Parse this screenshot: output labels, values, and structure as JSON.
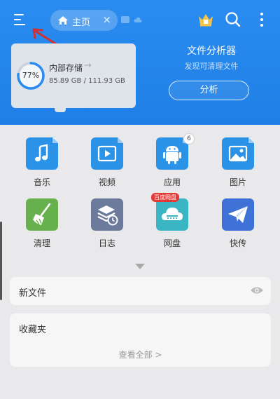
{
  "colors": {
    "accent": "#1f7fe6",
    "background": "#e9e9eb",
    "arrow": "#d32f2f"
  },
  "topbar": {
    "menu_icon": "hamburger-menu-icon",
    "tab": {
      "label": "主页",
      "icon": "home-icon",
      "close": "×"
    },
    "actions": [
      "crown-icon",
      "search-icon",
      "more-vertical-icon"
    ]
  },
  "storage": {
    "percent_label": "77%",
    "used_fraction": 0.77,
    "name": "内部存储",
    "arrow": "→",
    "size": "85.89 GB / 111.93 GB"
  },
  "analyzer": {
    "title": "文件分析器",
    "subtitle": "发现可清理文件",
    "button": "分析"
  },
  "categories": [
    {
      "label": "音乐",
      "icon": "music-icon",
      "color": "#2a93e8"
    },
    {
      "label": "视频",
      "icon": "video-icon",
      "color": "#2a93e8"
    },
    {
      "label": "应用",
      "icon": "android-icon",
      "color": "#2a93e8",
      "badge": "6"
    },
    {
      "label": "图片",
      "icon": "image-icon",
      "color": "#2a93e8"
    },
    {
      "label": "清理",
      "icon": "broom-icon",
      "color": "#66b04e"
    },
    {
      "label": "日志",
      "icon": "layers-clock-icon",
      "color": "#6c7a9c"
    },
    {
      "label": "网盘",
      "icon": "cloud-disk-icon",
      "color": "#3ab5c4",
      "tag": "百度网盘"
    },
    {
      "label": "快传",
      "icon": "paper-plane-icon",
      "color": "#3f72d6"
    }
  ],
  "new_files": {
    "label": "新文件"
  },
  "favorites": {
    "label": "收藏夹",
    "view_all": "查看全部 >"
  }
}
